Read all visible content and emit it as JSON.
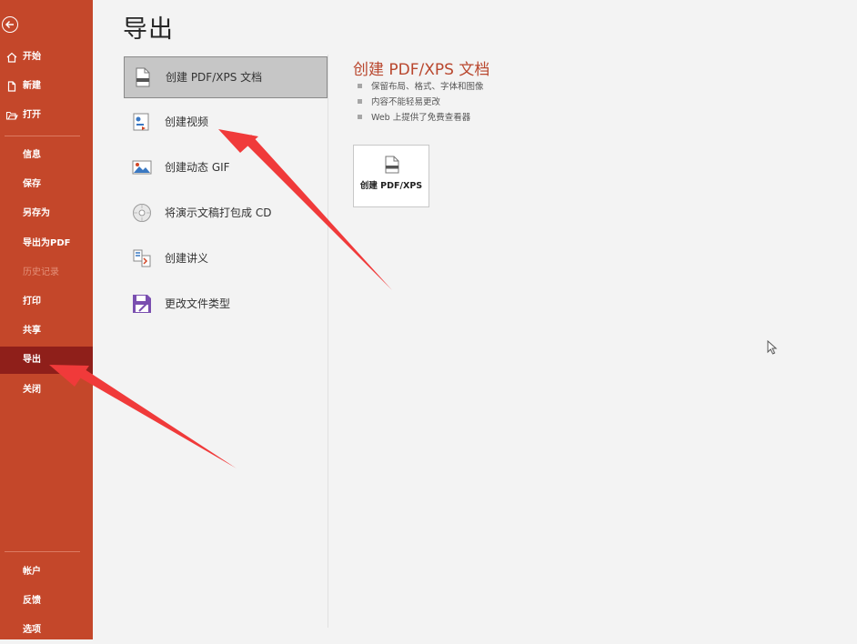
{
  "sidebar": {
    "back_icon": "back-arrow-circle-icon",
    "top_items": [
      {
        "label": "开始",
        "icon": "home-icon"
      },
      {
        "label": "新建",
        "icon": "new-document-icon"
      },
      {
        "label": "打开",
        "icon": "open-folder-icon"
      }
    ],
    "middle_items": [
      {
        "label": "信息"
      },
      {
        "label": "保存"
      },
      {
        "label": "另存为"
      },
      {
        "label": "导出为PDF"
      },
      {
        "label": "历史记录",
        "disabled": true
      },
      {
        "label": "打印"
      },
      {
        "label": "共享"
      },
      {
        "label": "导出",
        "active": true
      },
      {
        "label": "关闭"
      }
    ],
    "bottom_items": [
      {
        "label": "帐户"
      },
      {
        "label": "反馈"
      },
      {
        "label": "选项"
      }
    ]
  },
  "main": {
    "title": "导出",
    "export_options": [
      {
        "label": "创建 PDF/XPS 文档",
        "icon": "pdf-document-icon",
        "selected": true
      },
      {
        "label": "创建视频",
        "icon": "video-icon"
      },
      {
        "label": "创建动态 GIF",
        "icon": "gif-image-icon"
      },
      {
        "label": "将演示文稿打包成 CD",
        "icon": "cd-disc-icon"
      },
      {
        "label": "创建讲义",
        "icon": "handout-icon"
      },
      {
        "label": "更改文件类型",
        "icon": "save-as-type-icon"
      }
    ]
  },
  "detail": {
    "title": "创建 PDF/XPS 文档",
    "bullets": [
      "保留布局、格式、字体和图像",
      "内容不能轻易更改",
      "Web 上提供了免费查看器"
    ],
    "button_label": "创建 PDF/XPS",
    "button_icon": "pdf-document-icon"
  },
  "colors": {
    "sidebar_bg": "#c4472a",
    "sidebar_active": "#8f1f1a",
    "accent_title": "#b9472e",
    "annotation_arrow": "#f03a3a"
  }
}
